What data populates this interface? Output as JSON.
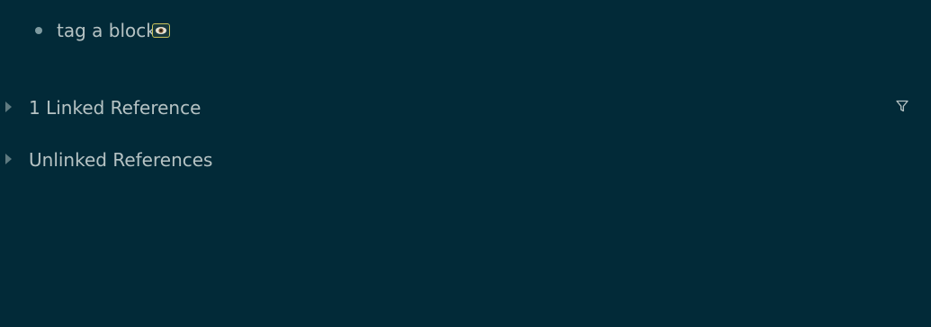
{
  "block": {
    "text": "tag a block",
    "tag_icon": "eye-emoji-icon"
  },
  "references": {
    "linked": {
      "title": "1 Linked Reference",
      "filter_icon": "filter-icon"
    },
    "unlinked": {
      "title": "Unlinked References"
    }
  },
  "colors": {
    "background": "#022a38",
    "text": "#b6c3c4",
    "bullet": "#7e9aa0",
    "tag_border": "#c9c35c"
  }
}
